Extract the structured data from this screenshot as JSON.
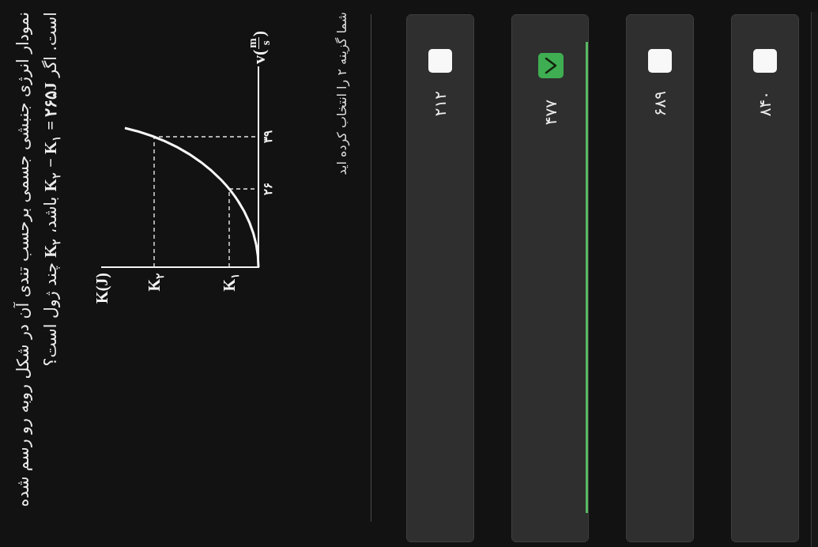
{
  "question": {
    "text": "نمودار انرژی جنبشی جسمی برحسب تندی آن در شکل روبه رو رسم شده است. اگر **K**$_{۲}$ **− K**$_{۱}$ **= ۲۶۵J** باشد، **K**$_{۲}$ چند ژول است؟"
  },
  "figure": {
    "y_axis_label": "K(J)",
    "y_ticks": [
      "K$_{۲}$",
      "K$_{۱}$"
    ],
    "x_ticks": [
      "۲۶",
      "۳۹"
    ],
    "x_axis_label": {
      "prefix": "v(",
      "numerator": "m",
      "denominator": "s",
      "suffix": ")"
    }
  },
  "feedback": "شما گزینه ۲ را انتخاب کرده اید",
  "options": [
    {
      "text": "۲۱۲",
      "selected": false
    },
    {
      "text": "۴۷۷",
      "selected": true
    },
    {
      "text": "۶۸۹",
      "selected": false
    },
    {
      "text": "۸۴۰",
      "selected": false
    }
  ]
}
